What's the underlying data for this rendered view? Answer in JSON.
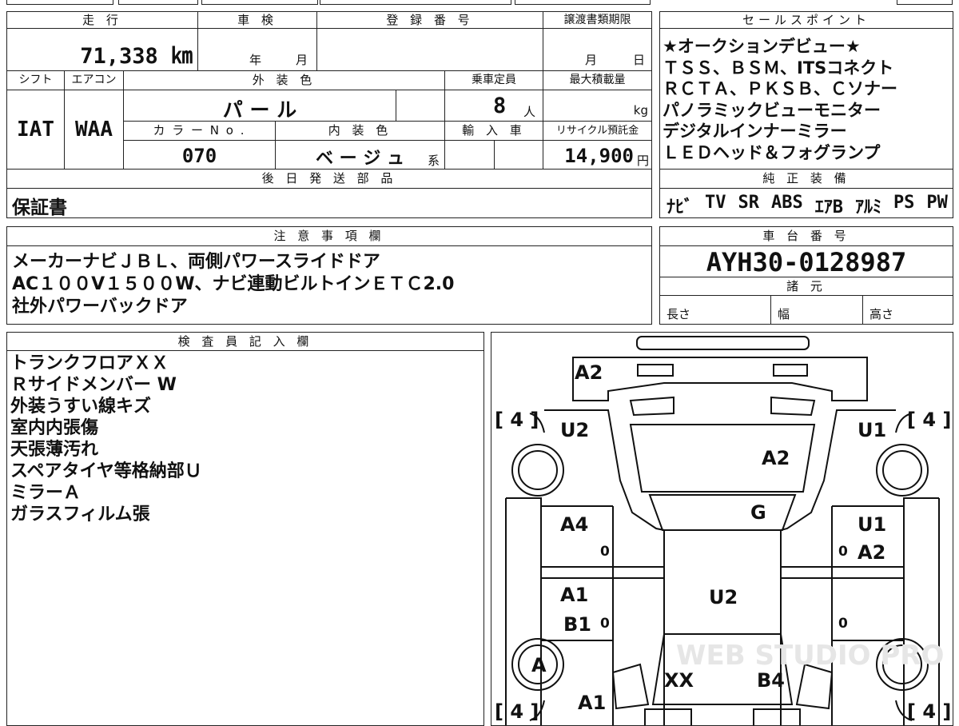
{
  "header": {
    "mileage_label": "走 行",
    "inspection_label": "車 検",
    "registration_label": "登 録 番 号",
    "transfer_deadline_label": "譲渡書類期限",
    "sales_points_label": "セールスポイント"
  },
  "values": {
    "mileage": "71,338 ㎞",
    "inspection_year_unit": "年",
    "inspection_month_unit": "月",
    "transfer_month_unit": "月",
    "transfer_day_unit": "日"
  },
  "row2_labels": {
    "shift": "シフト",
    "aircon": "エアコン",
    "exterior_color": "外 装 色",
    "capacity": "乗車定員",
    "max_load": "最大積載量",
    "color_no": "カ ラ ー N o .",
    "interior_color": "内 装 色",
    "import": "輸 入 車",
    "recycle_fee": "リサイクル預託金"
  },
  "row2_values": {
    "shift": "IAT",
    "aircon": "WAA",
    "exterior_color": "パ ー ル",
    "capacity": "8",
    "capacity_unit": "人",
    "load_unit": "kg",
    "color_no": "070",
    "interior_color": "ベ ー ジ ュ",
    "interior_suffix": "系",
    "recycle_fee": "14,900",
    "recycle_unit": "円"
  },
  "later_parts": {
    "label": "後 日 発 送 部 品",
    "value": "保証書"
  },
  "sales_points": [
    "★オークションデビュー★",
    "ＴＳＳ、ＢＳＭ、ITSコネクト",
    "ＲＣＴＡ、ＰＫＳＢ、Ｃソナー",
    "パノラミックビューモニター",
    "デジタルインナーミラー",
    "ＬＥＤヘッド＆フォグランプ"
  ],
  "equipment": {
    "label": "純 正 装 備",
    "items": [
      "ﾅﾋﾞ",
      "TV",
      "SR",
      "ABS",
      "ｴｱB",
      "ｱﾙﾐ",
      "PS",
      "PW"
    ]
  },
  "notes": {
    "label": "注 意 事 項 欄",
    "lines": [
      "メーカーナビＪＢＬ、両側パワースライドドア",
      "AC１００V１５００W、ナビ連動ビルトインＥＴＣ2.0",
      "社外パワーバックドア"
    ]
  },
  "chassis": {
    "label": "車 台 番 号",
    "value": "AYH30-0128987"
  },
  "specs": {
    "label": "諸 元",
    "length": "長さ",
    "width": "幅",
    "height": "高さ"
  },
  "inspector": {
    "label": "検 査 員 記 入 欄",
    "lines": [
      "トランクフロアＸＸ",
      "Ｒサイドメンバー W",
      "外装うすい線キズ",
      "室内内張傷",
      "天張薄汚れ",
      "スペアタイヤ等格納部Ｕ",
      "ミラーＡ",
      "ガラスフィルム張"
    ]
  },
  "diagram": {
    "tire_tl": "[ 4 ]",
    "tire_tr": "[ 4 ]",
    "tire_bl": "[ 4 ]",
    "tire_br": "[ 4 ]",
    "rear_bumper": "A2",
    "rear_left": "U2",
    "rear_right": "U1",
    "back_glass": "A2",
    "roof_front": "G",
    "left_rear_door": "A4",
    "right_rear_door_1": "U1",
    "right_rear_door_2": "A2",
    "left_front_door_1": "A1",
    "left_front_door_2": "B1",
    "roof": "U2",
    "left_wheel": "A",
    "hood_left": "XX",
    "hood_right": "B4",
    "front_left": "A1",
    "door_mark_left_1": "0",
    "door_mark_right_1": "0",
    "door_mark_left_2": "0",
    "door_mark_right_2": "0",
    "watermark": "WEB STUDIO PRO"
  }
}
